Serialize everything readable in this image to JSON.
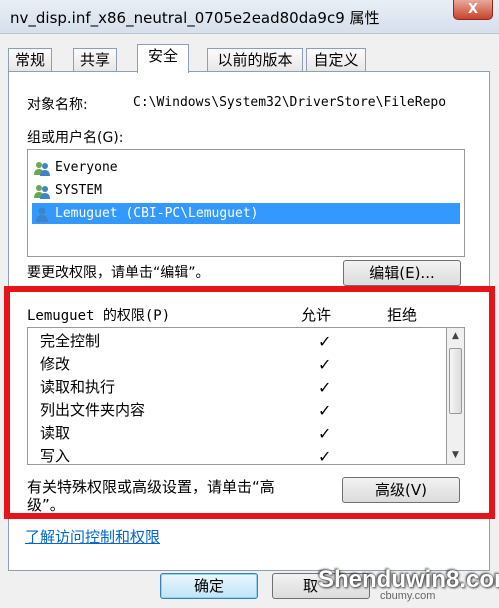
{
  "window": {
    "title": "nv_disp.inf_x86_neutral_0705e2ead80da9c9 属性",
    "close_label": "X"
  },
  "tabs": [
    {
      "label": "常规"
    },
    {
      "label": "共享"
    },
    {
      "label": "安全",
      "active": true
    },
    {
      "label": "以前的版本"
    },
    {
      "label": "自定义"
    }
  ],
  "object": {
    "label": "对象名称:",
    "value": "C:\\Windows\\System32\\DriverStore\\FileRepo"
  },
  "users": {
    "label": "组或用户名(G):",
    "items": [
      {
        "name": "Everyone",
        "icon": "group-users-icon"
      },
      {
        "name": "SYSTEM",
        "icon": "group-users-icon"
      },
      {
        "name": "Lemuguet (CBI-PC\\Lemuguet)",
        "icon": "user-icon",
        "selected": true
      }
    ]
  },
  "edit": {
    "hint": "要更改权限，请单击“编辑”。",
    "button": "编辑(E)..."
  },
  "permissions": {
    "header": "Lemuguet 的权限(P)",
    "allow": "允许",
    "deny": "拒绝",
    "items": [
      {
        "name": "完全控制",
        "check": "✓"
      },
      {
        "name": "修改",
        "check": "✓"
      },
      {
        "name": "读取和执行",
        "check": "✓"
      },
      {
        "name": "列出文件夹内容",
        "check": "✓"
      },
      {
        "name": "读取",
        "check": "✓"
      },
      {
        "name": "写入",
        "check": "✓"
      }
    ]
  },
  "advanced": {
    "hint_line1": "有关特殊权限或高级设置，请单击“高",
    "hint_line2": "级”。",
    "button": "高级(V)"
  },
  "help_link": "了解访问控制和权限",
  "footer": {
    "ok": "确定",
    "cancel": "取"
  },
  "watermark": {
    "main": "Shenduwin8.com",
    "sub": "cbumy.com"
  },
  "colors": {
    "highlight": "#e8121a",
    "selection": "#3399ff",
    "link": "#0066cc"
  }
}
